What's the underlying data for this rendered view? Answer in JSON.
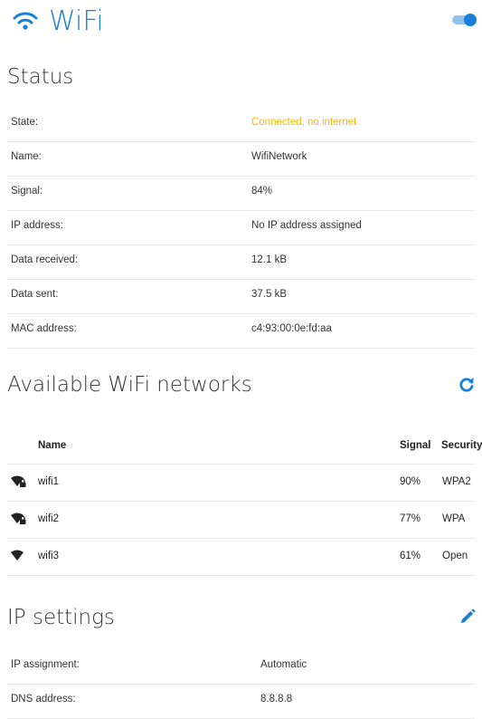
{
  "header": {
    "title": "WiFi",
    "toggle_on": true,
    "accent": "#1a7fd6"
  },
  "status": {
    "title": "Status",
    "rows": [
      {
        "label": "State:",
        "value": "Connected, no internet"
      },
      {
        "label": "Name:",
        "value": "WifiNetwork"
      },
      {
        "label": "Signal:",
        "value": "84%"
      },
      {
        "label": "IP address:",
        "value": "No IP address assigned"
      },
      {
        "label": "Data received:",
        "value": "12.1 kB"
      },
      {
        "label": "Data sent:",
        "value": "37.5 kB"
      },
      {
        "label": "MAC address:",
        "value": "c4:93:00:0e:fd:aa"
      }
    ],
    "warn_color": "#f5b800"
  },
  "networks": {
    "title": "Available WiFi networks",
    "columns": {
      "name": "Name",
      "signal": "Signal",
      "security": "Security"
    },
    "rows": [
      {
        "name": "wifi1",
        "signal": "90%",
        "security": "WPA2",
        "locked": true
      },
      {
        "name": "wifi2",
        "signal": "77%",
        "security": "WPA",
        "locked": true
      },
      {
        "name": "wifi3",
        "signal": "61%",
        "security": "Open",
        "locked": false
      }
    ]
  },
  "ip_settings": {
    "title": "IP settings",
    "rows": [
      {
        "label": "IP assignment:",
        "value": "Automatic"
      },
      {
        "label": "DNS address:",
        "value": "8.8.8.8"
      }
    ]
  }
}
